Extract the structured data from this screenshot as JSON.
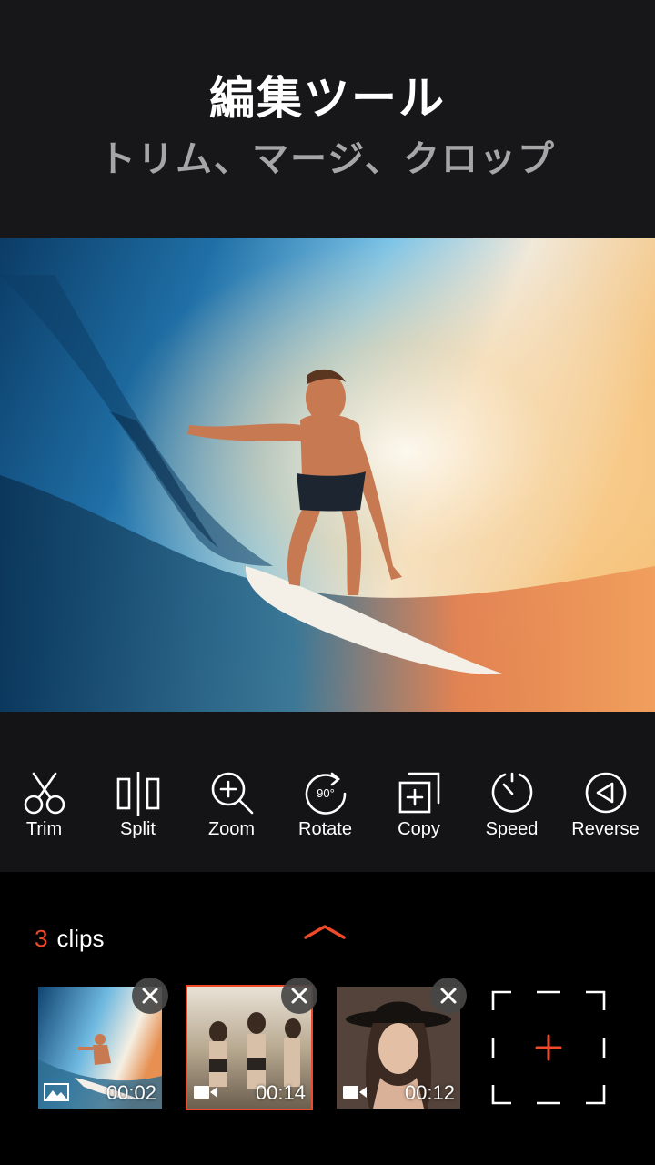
{
  "header": {
    "title": "編集ツール",
    "subtitle": "トリム、マージ、クロップ"
  },
  "tools": [
    {
      "label": "Trim",
      "icon": "scissors-icon"
    },
    {
      "label": "Split",
      "icon": "split-icon"
    },
    {
      "label": "Zoom",
      "icon": "zoom-in-icon"
    },
    {
      "label": "Rotate",
      "icon": "rotate-icon",
      "badge": "90°"
    },
    {
      "label": "Copy",
      "icon": "copy-icon"
    },
    {
      "label": "Speed",
      "icon": "speed-icon"
    },
    {
      "label": "Reverse",
      "icon": "reverse-icon"
    }
  ],
  "clips_panel": {
    "count": "3",
    "count_label": "clips",
    "clips": [
      {
        "type": "image-icon",
        "duration": "00:02",
        "selected": false
      },
      {
        "type": "video-icon",
        "duration": "00:14",
        "selected": true
      },
      {
        "type": "video-icon",
        "duration": "00:12",
        "selected": false
      }
    ],
    "add_icon": "plus-icon"
  },
  "colors": {
    "accent": "#f04a2a",
    "background": "#141416",
    "panel": "#000000",
    "subtitle": "#a6a6a6"
  }
}
